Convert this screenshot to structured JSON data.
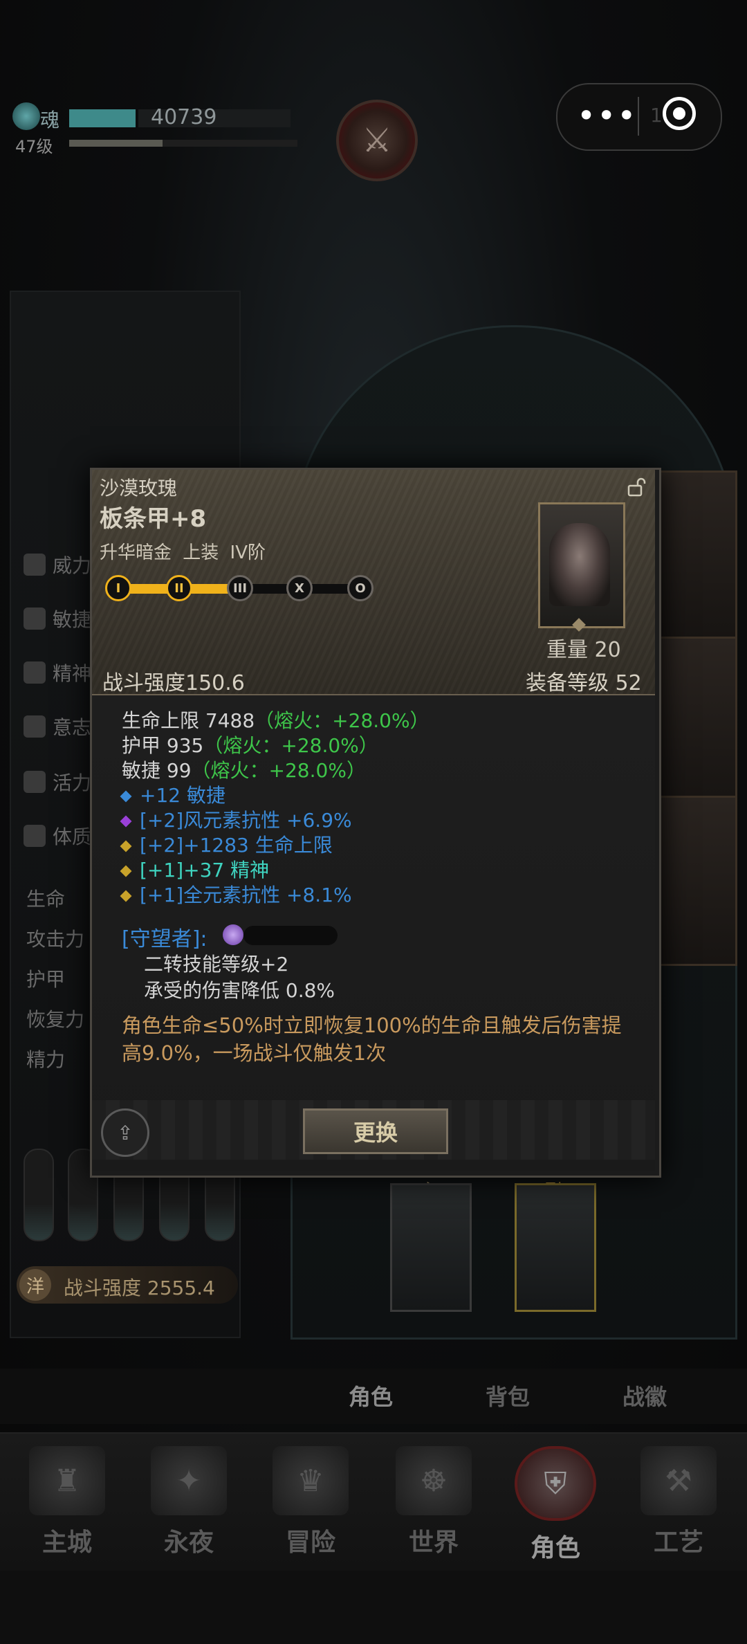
{
  "hud": {
    "soul_label": "魂",
    "soul_value": "40739",
    "level": "47级",
    "soul_fill": 0.3,
    "exp_fill": 0.41
  },
  "system_capsule": {
    "more_glyph": "•••",
    "peek_text": "1"
  },
  "background_stats": {
    "attributes": [
      "威力",
      "敏捷",
      "精神",
      "意志",
      "活力",
      "体质"
    ],
    "derived": [
      "生命",
      "攻击力",
      "护甲",
      "恢复力",
      "精力"
    ],
    "power_badge": "洋",
    "power_text": "战斗强度 2555.4"
  },
  "weapon_slots": {
    "main_label": "主",
    "off_label": "副"
  },
  "item": {
    "set_name": "沙漠玫瑰",
    "name": "板条甲+8",
    "tags": "升华暗金  上装  IV阶",
    "tier_nodes": [
      "I",
      "II",
      "III",
      "X",
      "O"
    ],
    "tier_lit": 2,
    "weight": "重量 20",
    "combat_power": "战斗强度150.6",
    "equip_level": "装备等级 52",
    "base_stats": [
      {
        "label": "生命上限  7488",
        "bonus": "（熔火：+28.0%）"
      },
      {
        "label": "护甲  935",
        "bonus": "（熔火：+28.0%）"
      },
      {
        "label": "敏捷  99",
        "bonus": "（熔火：+28.0%）"
      }
    ],
    "affixes": [
      {
        "color": "blue",
        "prefix": "",
        "text": "+12 敏捷"
      },
      {
        "color": "purple",
        "prefix": "[+2]",
        "text": "风元素抗性 +6.9%"
      },
      {
        "color": "gold",
        "prefix": "[+2]",
        "text": "+1283 生命上限"
      },
      {
        "color": "gold",
        "prefix": "[+1]",
        "text": "+37 精神"
      },
      {
        "color": "gold",
        "prefix": "[+1]",
        "text": "全元素抗性 +8.1%"
      }
    ],
    "guardian_title": "[守望者]:",
    "guardian_lines": [
      "二转技能等级+2",
      "承受的伤害降低 0.8%"
    ],
    "description": "角色生命≤50%时立即恢复100%的生命且触发后伤害提高9.0%，一场战斗仅触发1次",
    "replace_button": "更换",
    "share_icon": "share-icon",
    "lock_icon": "unlock-icon"
  },
  "subtabs": [
    "角色",
    "背包",
    "战徽"
  ],
  "subtab_active": 0,
  "nav": [
    "主城",
    "永夜",
    "冒险",
    "世界",
    "角色",
    "工艺"
  ],
  "nav_active": 4,
  "colors": {
    "green_bonus": "#3ec64a",
    "blue_affix": "#3a8ad8",
    "gold_tier": "#f0b21b",
    "desc_orange": "#c99a5e"
  }
}
